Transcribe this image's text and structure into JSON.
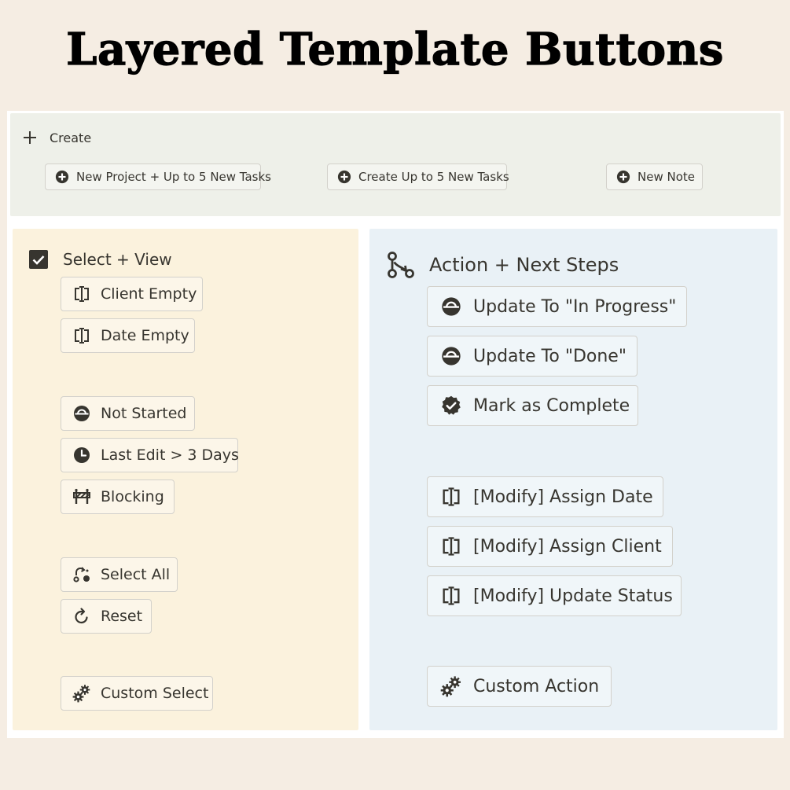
{
  "title": "Layered Template Buttons",
  "create": {
    "heading": "Create",
    "buttons": [
      {
        "label": "New Project + Up to 5 New Tasks",
        "icon": "plus-circle-icon"
      },
      {
        "label": "Create Up to 5 New Tasks",
        "icon": "plus-circle-icon"
      },
      {
        "label": "New Note",
        "icon": "plus-circle-icon"
      }
    ]
  },
  "select": {
    "heading": "Select + View",
    "buttons": [
      {
        "label": "Client Empty",
        "icon": "text-cursor-icon"
      },
      {
        "label": "Date Empty",
        "icon": "text-cursor-icon"
      },
      {
        "label": "Not Started",
        "icon": "progress-circle-icon"
      },
      {
        "label": "Last Edit > 3 Days",
        "icon": "clock-icon"
      },
      {
        "label": "Blocking",
        "icon": "barrier-icon"
      },
      {
        "label": "Select All",
        "icon": "select-all-icon"
      },
      {
        "label": "Reset",
        "icon": "reset-icon"
      },
      {
        "label": "Custom Select",
        "icon": "gears-icon"
      }
    ]
  },
  "action": {
    "heading": "Action + Next Steps",
    "buttons": [
      {
        "label": "Update To \"In Progress\"",
        "icon": "progress-circle-icon"
      },
      {
        "label": "Update To \"Done\"",
        "icon": "progress-circle-icon"
      },
      {
        "label": "Mark as Complete",
        "icon": "verified-badge-icon"
      },
      {
        "label": "[Modify] Assign Date",
        "icon": "text-cursor-icon"
      },
      {
        "label": "[Modify] Assign Client",
        "icon": "text-cursor-icon"
      },
      {
        "label": "[Modify] Update Status",
        "icon": "text-cursor-icon"
      },
      {
        "label": "Custom Action",
        "icon": "gears-icon"
      }
    ]
  }
}
